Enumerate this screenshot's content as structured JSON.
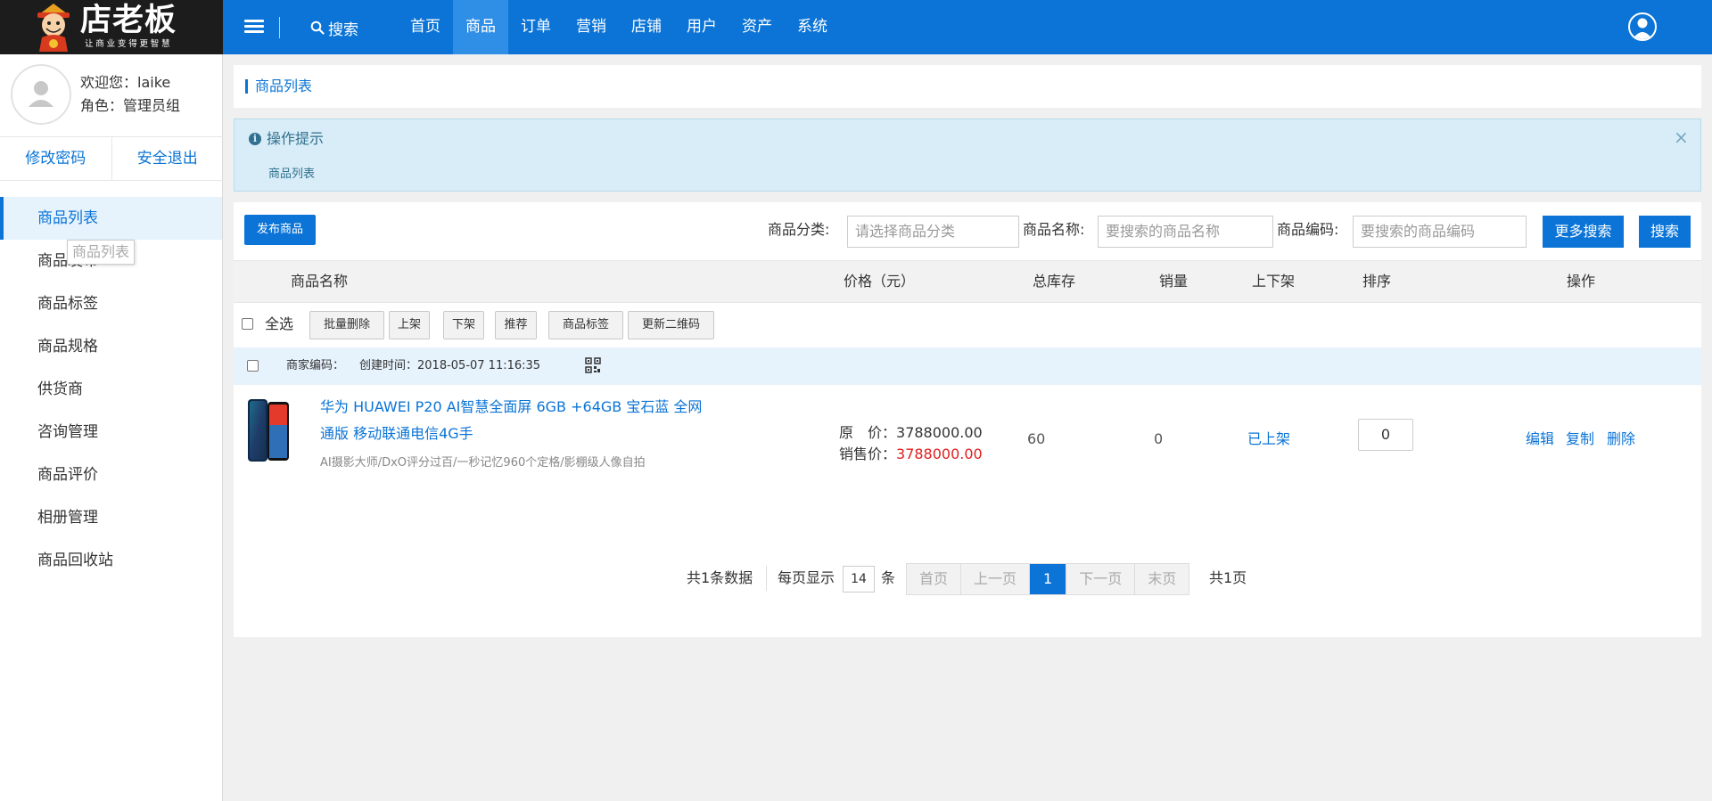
{
  "colors": {
    "primary": "#0b74d6",
    "nav_active": "#2f8fe7",
    "logo_bg": "#1c1c1c",
    "price_red": "#e02020",
    "tips_bg": "#d8edf7"
  },
  "logo": {
    "title": "店老板",
    "slogan": "让商业变得更智慧"
  },
  "header": {
    "search_label": "搜索",
    "nav": [
      "首页",
      "商品",
      "订单",
      "营销",
      "店铺",
      "用户",
      "资产",
      "系统"
    ],
    "active_nav": "商品"
  },
  "user": {
    "welcome": "欢迎您：laike",
    "role": "角色：管理员组"
  },
  "account": {
    "change_password": "修改密码",
    "logout": "安全退出"
  },
  "sidebar": {
    "items": [
      "商品列表",
      "商品发布",
      "商品标签",
      "商品规格",
      "供货商",
      "咨询管理",
      "商品评价",
      "相册管理",
      "商品回收站"
    ],
    "active": "商品列表",
    "tooltip": "商品列表"
  },
  "breadcrumb": "商品列表",
  "tips": {
    "title": "操作提示",
    "text": "商品列表",
    "close": "×"
  },
  "toolbar": {
    "publish": "发布商品",
    "category_label": "商品分类:",
    "category_placeholder": "请选择商品分类",
    "name_label": "商品名称:",
    "name_placeholder": "要搜索的商品名称",
    "code_label": "商品编码:",
    "code_placeholder": "要搜索的商品编码",
    "more_search": "更多搜索",
    "search": "搜索"
  },
  "table": {
    "headers": [
      "商品名称",
      "价格（元）",
      "总库存",
      "销量",
      "上下架",
      "排序",
      "操作"
    ],
    "select_all": "全选",
    "bulk_actions": [
      "批量删除",
      "上架",
      "下架",
      "推荐",
      "商品标签",
      "更新二维码"
    ]
  },
  "store_row": {
    "merchant_code": "商家编码：",
    "created": "创建时间：2018-05-07 11:16:35"
  },
  "products": [
    {
      "title": "华为 HUAWEI P20 AI智慧全面屏 6GB +64GB 宝石蓝 全网通版 移动联通电信4G手",
      "desc": "AI摄影大师/DxO评分过百/一秒记忆960个定格/影棚级人像自拍",
      "original_label": "原　价：",
      "original_price": "3788000.00",
      "sale_label": "销售价：",
      "sale_price": "3788000.00",
      "stock": "60",
      "sales": "0",
      "status": "已上架",
      "sort": "0",
      "ops": [
        "编辑",
        "复制",
        "删除"
      ]
    }
  ],
  "pagination": {
    "total": "共1条数据",
    "per_page_label": "每页显示",
    "per_page": "14",
    "unit": "条",
    "first": "首页",
    "prev": "上一页",
    "current": "1",
    "next": "下一页",
    "last": "末页",
    "pages": "共1页"
  }
}
